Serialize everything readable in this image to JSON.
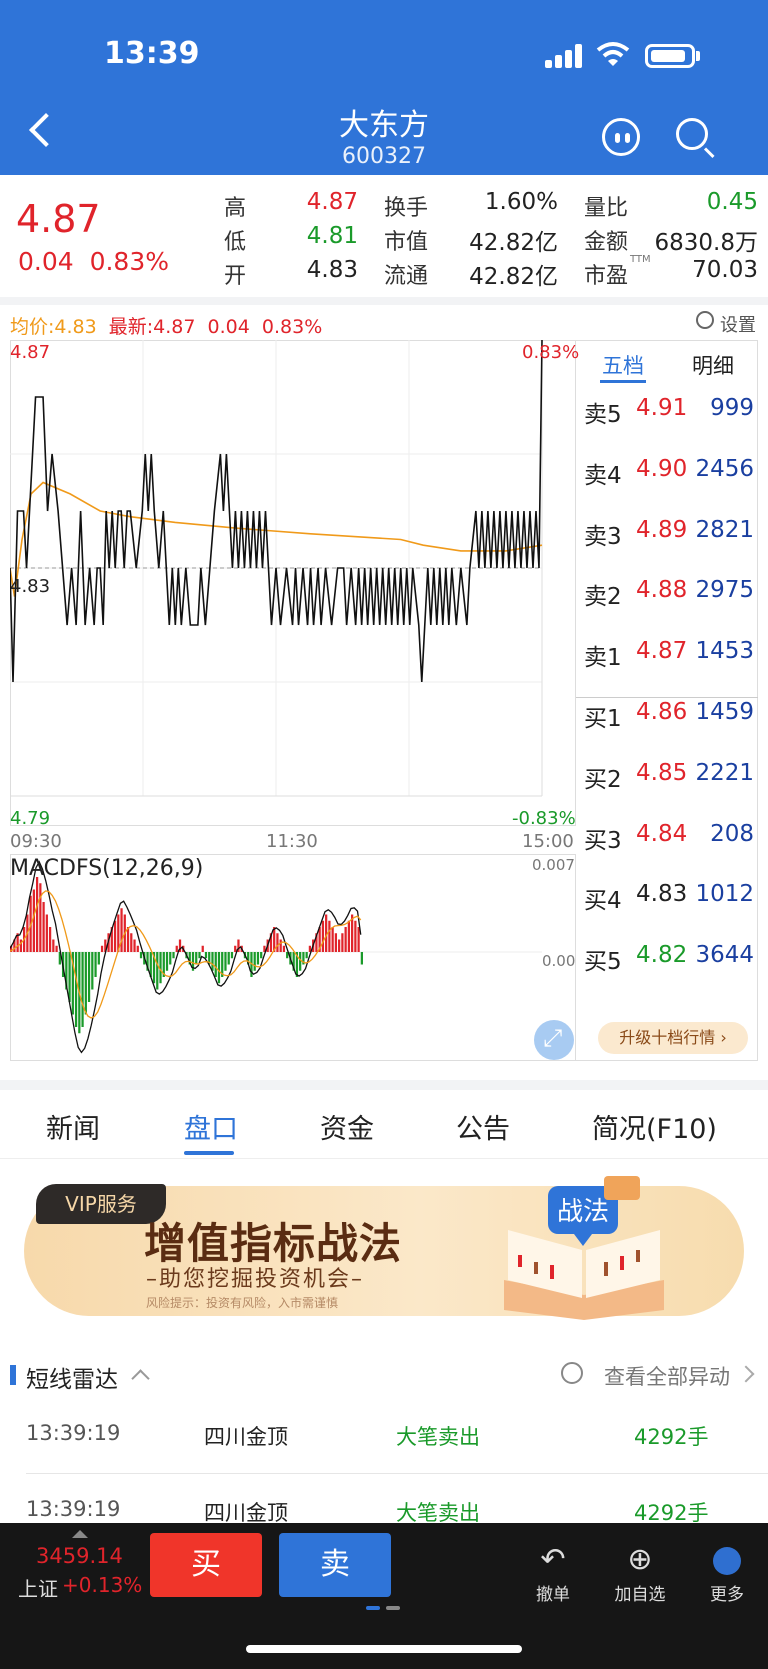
{
  "status_bar": {
    "time": "13:39"
  },
  "header": {
    "name": "大东方",
    "code": "600327"
  },
  "quote": {
    "price": "4.87",
    "change": "0.04",
    "change_pct": "0.83%",
    "stats": {
      "high_label": "高",
      "high": "4.87",
      "low_label": "低",
      "low": "4.81",
      "open_label": "开",
      "open": "4.83",
      "turnover_label": "换手",
      "turnover": "1.60%",
      "mcap_label": "市值",
      "mcap": "42.82亿",
      "float_label": "流通",
      "float_cap": "42.82亿",
      "vol_ratio_label": "量比",
      "vol_ratio": "0.45",
      "amount_label": "金额",
      "amount": "6830.8万",
      "pe_label": "市盈",
      "pe_sup": "TTM",
      "pe": "70.03"
    }
  },
  "chart_header": {
    "avg_label": "均价:4.83",
    "latest_label": "最新:4.87",
    "latest_change": "0.04",
    "latest_pct": "0.83%",
    "settings_label": "设置"
  },
  "chart_data": [
    {
      "type": "line",
      "title": "",
      "x_ticks": [
        "09:30",
        "11:30",
        "15:00"
      ],
      "ylim": [
        4.79,
        4.87
      ],
      "y_left_labels": {
        "top": "4.87",
        "mid": "4.83",
        "bottom": "4.79"
      },
      "y_right_labels": {
        "top": "0.83%",
        "bottom": "-0.83%"
      },
      "prev_close": 4.83,
      "series": [
        {
          "name": "最新",
          "values": [
            4.83,
            4.81,
            4.84,
            4.84,
            4.83,
            4.86,
            4.86,
            4.83,
            4.84,
            4.84,
            4.83,
            4.82,
            4.83,
            4.82,
            4.84,
            4.82,
            4.83,
            4.83,
            4.82,
            4.83,
            4.84,
            4.84,
            4.83,
            4.84,
            4.83,
            4.83,
            4.84,
            4.84,
            4.83,
            4.83,
            4.83,
            4.82,
            4.84,
            4.82,
            4.84,
            4.83,
            4.84,
            4.84,
            4.82,
            4.84,
            4.84,
            4.83,
            4.84,
            4.84,
            4.83,
            4.84,
            4.84,
            4.83,
            4.84,
            4.84,
            4.83,
            4.83,
            4.84,
            4.84,
            4.83,
            4.84,
            4.84,
            4.83,
            4.83,
            4.84,
            4.84,
            4.85,
            4.83,
            4.84,
            4.84,
            4.84,
            4.84,
            4.83,
            4.84,
            4.84,
            4.84,
            4.84,
            4.83,
            4.84,
            4.84,
            4.84,
            4.84,
            4.83,
            4.83,
            4.83,
            4.83,
            4.84,
            4.84,
            4.83,
            4.84,
            4.84,
            4.84,
            4.84,
            4.83,
            4.84,
            4.84,
            4.84,
            4.84,
            4.83,
            4.84,
            4.84,
            4.84,
            4.84,
            4.83,
            4.84,
            4.84,
            4.84,
            4.84,
            4.83,
            4.84,
            4.84,
            4.84,
            4.84,
            4.83,
            4.84,
            4.84,
            4.84,
            4.84,
            4.83,
            4.84,
            4.84,
            4.84,
            4.84,
            4.83,
            4.84,
            4.84,
            4.84,
            4.84,
            4.83,
            4.84,
            4.84,
            4.84,
            4.84,
            4.83,
            4.84,
            4.84,
            4.84,
            4.84,
            4.83,
            4.84,
            4.84,
            4.84,
            4.84,
            4.83,
            4.84,
            4.84,
            4.84,
            4.84,
            4.83,
            4.84,
            4.84,
            4.84,
            4.84,
            4.83,
            4.84,
            4.84,
            4.84,
            4.84,
            4.83,
            4.84,
            4.84,
            4.84,
            4.84,
            4.83,
            4.84,
            4.84,
            4.84,
            4.84,
            4.83,
            4.84,
            4.84,
            4.84,
            4.84,
            4.83,
            4.84,
            4.84,
            4.84,
            4.84,
            4.83,
            4.84,
            4.84,
            4.84,
            4.84,
            4.83,
            4.84,
            4.84,
            4.84,
            4.84,
            4.83,
            4.84,
            4.84,
            4.84,
            4.84,
            4.83,
            4.84,
            4.84,
            4.84,
            4.84,
            4.83,
            4.84,
            4.84,
            4.84,
            4.84,
            4.83,
            4.84,
            4.84,
            4.84,
            4.84,
            4.83,
            4.84,
            4.84,
            4.84,
            4.84,
            4.83,
            4.84,
            4.84,
            4.84,
            4.84,
            4.83,
            4.84,
            4.84,
            4.84,
            4.84,
            4.83,
            4.84,
            4.84,
            4.84,
            4.84,
            4.83,
            4.84,
            4.84,
            4.84,
            4.84,
            4.83,
            4.84,
            4.84,
            4.84,
            4.84,
            4.83,
            4.84,
            4.84,
            4.84,
            4.87
          ]
        },
        {
          "name": "均价"
        }
      ]
    },
    {
      "type": "bar",
      "title": "MACDFS(12,26,9)",
      "y_labels": [
        "0.007",
        "0.00"
      ]
    }
  ],
  "intraday_price": [
    [
      0,
      4.83
    ],
    [
      2,
      4.81
    ],
    [
      5,
      4.84
    ],
    [
      9,
      4.84
    ],
    [
      11,
      4.83
    ],
    [
      17,
      4.86
    ],
    [
      22,
      4.86
    ],
    [
      25,
      4.84
    ],
    [
      28,
      4.85
    ],
    [
      32,
      4.84
    ],
    [
      35,
      4.83
    ],
    [
      38,
      4.82
    ],
    [
      41,
      4.83
    ],
    [
      44,
      4.82
    ],
    [
      47,
      4.84
    ],
    [
      50,
      4.82
    ],
    [
      53,
      4.83
    ],
    [
      56,
      4.82
    ],
    [
      58,
      4.83
    ],
    [
      60,
      4.83
    ],
    [
      62,
      4.82
    ],
    [
      64,
      4.84
    ],
    [
      66,
      4.83
    ],
    [
      68,
      4.84
    ],
    [
      70,
      4.83
    ],
    [
      72,
      4.84
    ],
    [
      74,
      4.84
    ],
    [
      76,
      4.83
    ],
    [
      78,
      4.84
    ],
    [
      80,
      4.84
    ],
    [
      84,
      4.83
    ],
    [
      88,
      4.84
    ],
    [
      90,
      4.85
    ],
    [
      92,
      4.84
    ],
    [
      94,
      4.85
    ],
    [
      96,
      4.84
    ],
    [
      99,
      4.83
    ],
    [
      102,
      4.84
    ],
    [
      104,
      4.83
    ],
    [
      106,
      4.82
    ],
    [
      108,
      4.83
    ],
    [
      110,
      4.82
    ],
    [
      112,
      4.83
    ],
    [
      114,
      4.82
    ],
    [
      117,
      4.83
    ],
    [
      120,
      4.82
    ],
    [
      125,
      4.82
    ],
    [
      127,
      4.83
    ],
    [
      130,
      4.82
    ],
    [
      133,
      4.83
    ],
    [
      136,
      4.84
    ],
    [
      140,
      4.85
    ],
    [
      142,
      4.84
    ],
    [
      144,
      4.85
    ],
    [
      146,
      4.84
    ],
    [
      148,
      4.83
    ],
    [
      150,
      4.84
    ],
    [
      152,
      4.83
    ],
    [
      154,
      4.84
    ],
    [
      156,
      4.83
    ],
    [
      158,
      4.84
    ],
    [
      160,
      4.83
    ],
    [
      162,
      4.84
    ],
    [
      164,
      4.83
    ],
    [
      166,
      4.84
    ],
    [
      168,
      4.83
    ],
    [
      170,
      4.84
    ],
    [
      172,
      4.83
    ],
    [
      174,
      4.82
    ],
    [
      177,
      4.83
    ],
    [
      180,
      4.82
    ],
    [
      184,
      4.83
    ],
    [
      188,
      4.82
    ],
    [
      190,
      4.83
    ],
    [
      192,
      4.82
    ],
    [
      195,
      4.83
    ],
    [
      198,
      4.82
    ],
    [
      200,
      4.83
    ],
    [
      202,
      4.82
    ],
    [
      205,
      4.83
    ],
    [
      207,
      4.82
    ],
    [
      210,
      4.83
    ],
    [
      214,
      4.82
    ],
    [
      218,
      4.83
    ],
    [
      222,
      4.83
    ],
    [
      224,
      4.82
    ],
    [
      227,
      4.83
    ],
    [
      230,
      4.82
    ],
    [
      232,
      4.83
    ],
    [
      234,
      4.82
    ],
    [
      236,
      4.83
    ],
    [
      238,
      4.82
    ],
    [
      240,
      4.83
    ],
    [
      242,
      4.82
    ],
    [
      244,
      4.83
    ],
    [
      246,
      4.82
    ],
    [
      248,
      4.83
    ],
    [
      250,
      4.82
    ],
    [
      252,
      4.83
    ],
    [
      254,
      4.82
    ],
    [
      256,
      4.83
    ],
    [
      258,
      4.82
    ],
    [
      260,
      4.83
    ],
    [
      262,
      4.82
    ],
    [
      264,
      4.83
    ],
    [
      266,
      4.82
    ],
    [
      268,
      4.83
    ],
    [
      272,
      4.82
    ],
    [
      274,
      4.81
    ],
    [
      276,
      4.82
    ],
    [
      278,
      4.83
    ],
    [
      280,
      4.82
    ],
    [
      282,
      4.83
    ],
    [
      284,
      4.82
    ],
    [
      286,
      4.83
    ],
    [
      288,
      4.82
    ],
    [
      290,
      4.83
    ],
    [
      292,
      4.82
    ],
    [
      294,
      4.83
    ],
    [
      297,
      4.82
    ],
    [
      300,
      4.83
    ],
    [
      304,
      4.82
    ],
    [
      306,
      4.83
    ],
    [
      310,
      4.84
    ],
    [
      312,
      4.83
    ],
    [
      314,
      4.84
    ],
    [
      316,
      4.83
    ],
    [
      318,
      4.84
    ],
    [
      320,
      4.83
    ],
    [
      322,
      4.84
    ],
    [
      324,
      4.83
    ],
    [
      326,
      4.84
    ],
    [
      328,
      4.83
    ],
    [
      330,
      4.84
    ],
    [
      332,
      4.83
    ],
    [
      334,
      4.84
    ],
    [
      336,
      4.83
    ],
    [
      338,
      4.84
    ],
    [
      340,
      4.83
    ],
    [
      342,
      4.84
    ],
    [
      344,
      4.83
    ],
    [
      346,
      4.84
    ],
    [
      348,
      4.83
    ],
    [
      350,
      4.84
    ],
    [
      352,
      4.83
    ],
    [
      354,
      4.87
    ]
  ],
  "intraday_avg": [
    [
      0,
      4.83
    ],
    [
      3,
      4.825
    ],
    [
      8,
      4.835
    ],
    [
      14,
      4.843
    ],
    [
      22,
      4.845
    ],
    [
      40,
      4.843
    ],
    [
      60,
      4.84
    ],
    [
      80,
      4.839
    ],
    [
      110,
      4.838
    ],
    [
      150,
      4.837
    ],
    [
      200,
      4.836
    ],
    [
      260,
      4.835
    ],
    [
      275,
      4.834
    ],
    [
      300,
      4.833
    ],
    [
      330,
      4.833
    ],
    [
      354,
      4.834
    ]
  ],
  "macd": [
    0.0005,
    0.001,
    0.0015,
    0.001,
    0.002,
    0.003,
    0.0045,
    0.005,
    0.006,
    0.0055,
    0.004,
    0.003,
    0.002,
    0.001,
    0.0005,
    -0.001,
    -0.002,
    -0.003,
    -0.004,
    -0.005,
    -0.006,
    -0.0065,
    -0.006,
    -0.005,
    -0.004,
    -0.003,
    -0.002,
    -0.001,
    0.0005,
    0.001,
    0.0015,
    0.002,
    0.0025,
    0.003,
    0.0035,
    0.003,
    0.002,
    0.0015,
    0.001,
    0.0005,
    -0.0005,
    -0.001,
    -0.0015,
    -0.002,
    -0.0025,
    -0.003,
    -0.0025,
    -0.002,
    -0.0015,
    -0.001,
    -0.0005,
    0.0005,
    0.001,
    0.0005,
    -0.0005,
    -0.001,
    -0.0015,
    -0.001,
    -0.0005,
    0.0005,
    -0.0005,
    -0.001,
    -0.0015,
    -0.002,
    -0.0025,
    -0.002,
    -0.0015,
    -0.001,
    -0.0005,
    0.0005,
    0.001,
    0.0005,
    -0.0005,
    -0.001,
    -0.002,
    -0.0015,
    -0.001,
    -0.0005,
    0.0005,
    0.001,
    0.0015,
    0.002,
    0.0015,
    0.001,
    0.0005,
    -0.0005,
    -0.001,
    -0.0015,
    -0.002,
    -0.0015,
    -0.001,
    -0.0005,
    0.0005,
    0.001,
    0.0015,
    0.002,
    0.0025,
    0.003,
    0.0025,
    0.002,
    0.0015,
    0.001,
    0.0015,
    0.002,
    0.0025,
    0.003,
    0.0025,
    0.002,
    -0.001
  ],
  "orderbook": {
    "tabs": [
      "五档",
      "明细"
    ],
    "asks": [
      {
        "level": "卖5",
        "price": "4.91",
        "vol": "999"
      },
      {
        "level": "卖4",
        "price": "4.90",
        "vol": "2456"
      },
      {
        "level": "卖3",
        "price": "4.89",
        "vol": "2821"
      },
      {
        "level": "卖2",
        "price": "4.88",
        "vol": "2975"
      },
      {
        "level": "卖1",
        "price": "4.87",
        "vol": "1453"
      }
    ],
    "bids": [
      {
        "level": "买1",
        "price": "4.86",
        "vol": "1459"
      },
      {
        "level": "买2",
        "price": "4.85",
        "vol": "2221"
      },
      {
        "level": "买3",
        "price": "4.84",
        "vol": "208"
      },
      {
        "level": "买4",
        "price": "4.83",
        "vol": "1012"
      },
      {
        "level": "买5",
        "price": "4.82",
        "vol": "3644"
      }
    ],
    "upgrade_label": "升级十档行情 ›"
  },
  "tabs": [
    "新闻",
    "盘口",
    "资金",
    "公告",
    "简况(F10)"
  ],
  "banner": {
    "tag": "VIP服务",
    "title": "增值指标战法",
    "subtitle": "–助您挖掘投资机会–",
    "note": "风险提示：投资有风险，入市需谨慎",
    "book_label": "战法"
  },
  "radar": {
    "title": "短线雷达",
    "view_all": "查看全部异动",
    "rows": [
      {
        "time": "13:39:19",
        "name": "四川金顶",
        "event": "大笔卖出",
        "qty": "4292手"
      },
      {
        "time": "13:39:19",
        "name": "四川金顶",
        "event": "大笔卖出",
        "qty": "4292手"
      }
    ]
  },
  "bottom_bar": {
    "index_value": "3459.14",
    "index_name": "上证",
    "index_change": "+0.13%",
    "buy": "买",
    "sell": "卖",
    "actions": [
      {
        "label": "撤单",
        "icon": "undo-icon"
      },
      {
        "label": "加自选",
        "icon": "add-circle-icon"
      },
      {
        "label": "更多",
        "icon": "more-icon"
      }
    ]
  },
  "colors": {
    "brand": "#2f74d8",
    "up": "#e0242b",
    "down": "#1a9a2a",
    "vol": "#1a3fa0"
  }
}
